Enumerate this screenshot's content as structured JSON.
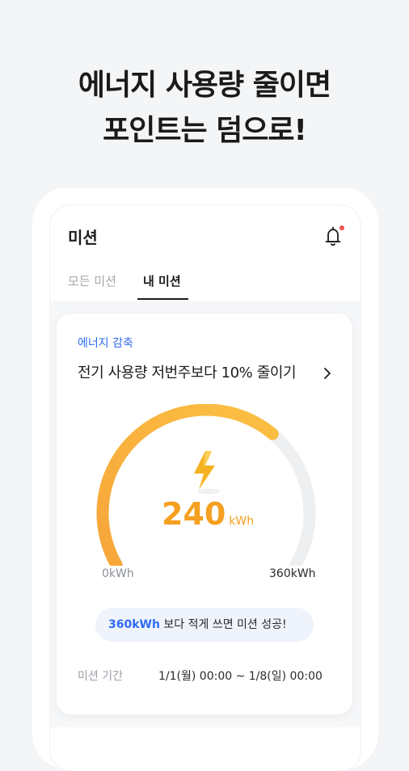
{
  "headline": {
    "line1": "에너지 사용량 줄이면",
    "line2": "포인트는 덤으로!"
  },
  "app": {
    "title": "미션",
    "notification_icon": "bell-icon",
    "notification_dot_color": "#f0524b"
  },
  "tabs": [
    {
      "label": "모든 미션",
      "active": false
    },
    {
      "label": "내 미션",
      "active": true
    }
  ],
  "mission": {
    "category": "에너지 감축",
    "title": "전기 사용량 저번주보다 10% 줄이기",
    "chevron_icon": "chevron-right-icon",
    "gauge": {
      "icon": "lightning-bolt-icon",
      "value": 240,
      "value_label": "240",
      "unit": "kWh",
      "min": 0,
      "max": 360,
      "min_label": "0kWh",
      "max_label": "360kWh",
      "accent_color": "#f5a020",
      "track_color": "#eeeff1"
    },
    "hint": {
      "highlight": "360kWh",
      "text": " 보다 적게 쓰면 미션 성공!"
    },
    "period": {
      "label": "미션 기간",
      "value": "1/1(월) 00:00 ~ 1/8(일) 00:00"
    }
  }
}
